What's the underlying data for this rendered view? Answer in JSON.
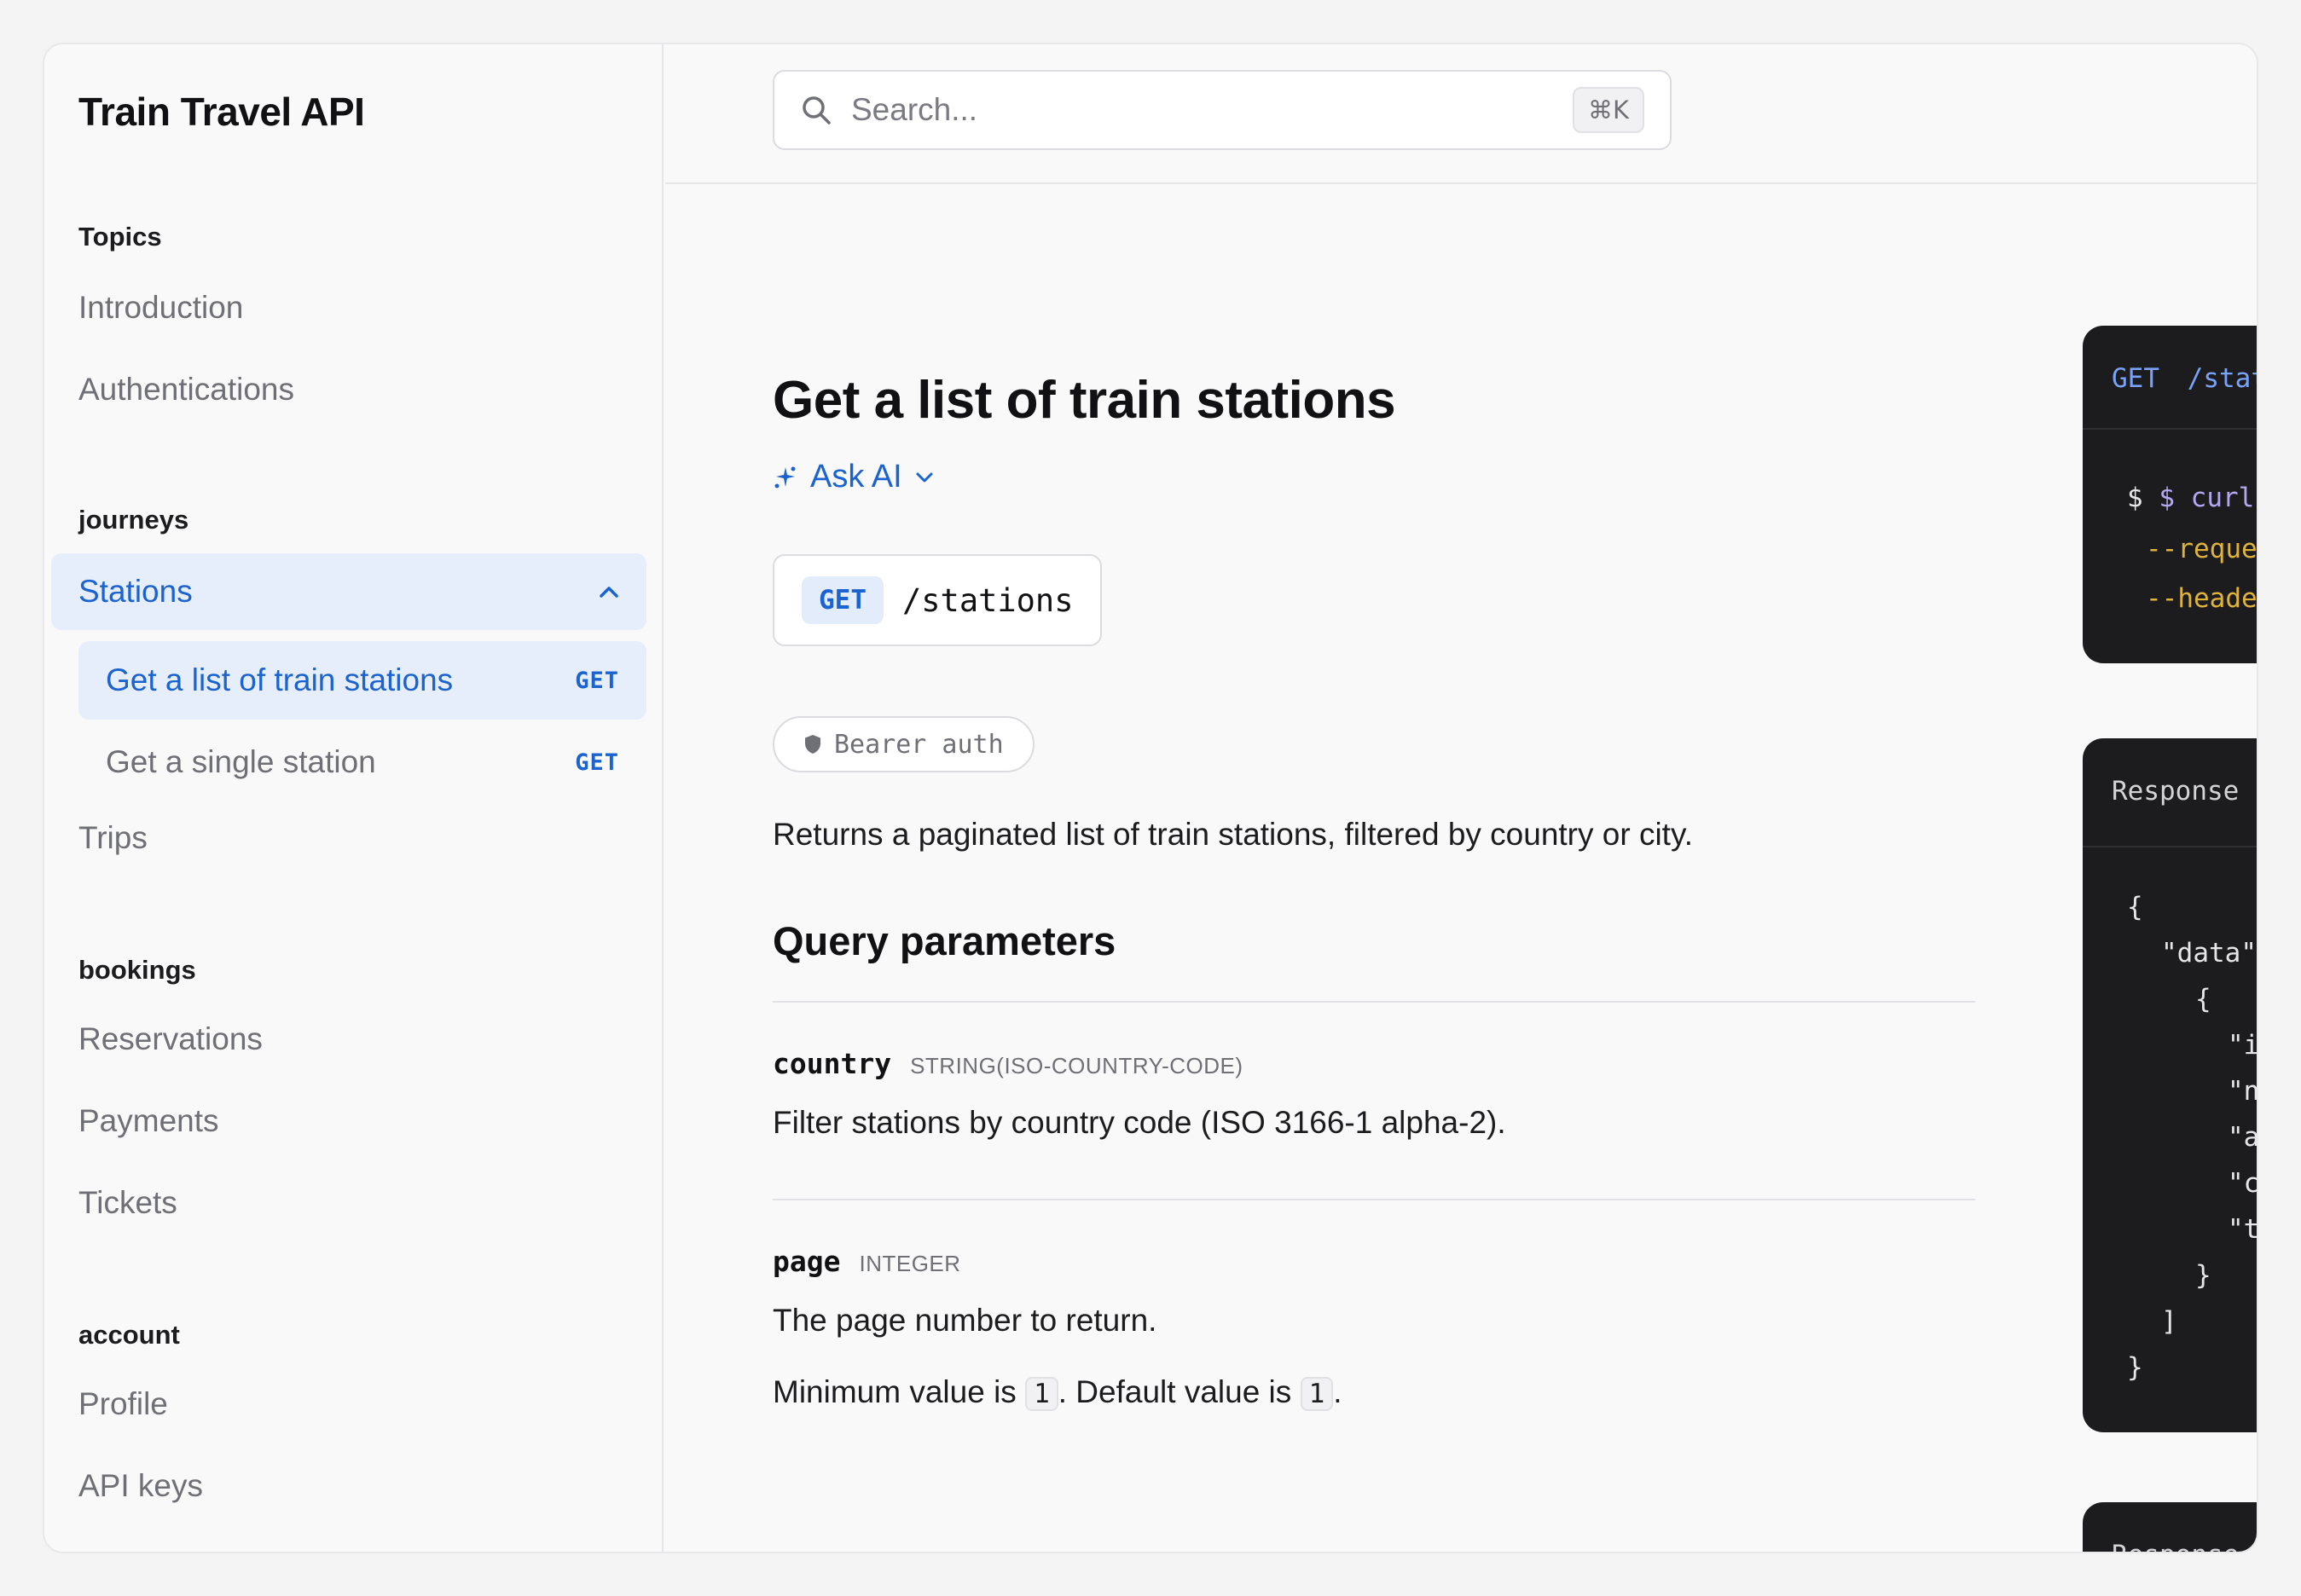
{
  "sidebar": {
    "brand": "Train Travel API",
    "sections": {
      "topics": {
        "title": "Topics",
        "items": [
          "Introduction",
          "Authentications"
        ]
      },
      "journeys": {
        "title": "journeys",
        "group": "Stations",
        "sub_items": [
          {
            "label": "Get a list of train stations",
            "method": "GET"
          },
          {
            "label": "Get a single station",
            "method": "GET"
          }
        ],
        "items": [
          "Trips"
        ]
      },
      "bookings": {
        "title": "bookings",
        "items": [
          "Reservations",
          "Payments",
          "Tickets"
        ]
      },
      "account": {
        "title": "account",
        "items": [
          "Profile",
          "API keys"
        ]
      }
    }
  },
  "search": {
    "placeholder": "Search...",
    "shortcut": "⌘K"
  },
  "main": {
    "title": "Get a list of train stations",
    "ask_ai": "Ask AI",
    "endpoint": {
      "method": "GET",
      "path": "/stations"
    },
    "auth": "Bearer auth",
    "description": "Returns a paginated list of train stations, filtered by country or city.",
    "query_heading": "Query parameters",
    "params": [
      {
        "name": "country",
        "type": "STRING(ISO-COUNTRY-CODE)",
        "description": "Filter stations by country code (ISO 3166-1 alpha-2)."
      },
      {
        "name": "page",
        "type": "INTEGER",
        "description": "The page number to return.",
        "constraint_prefix": "Minimum value is ",
        "min": "1",
        "constraint_mid": ". Default value is ",
        "default": "1",
        "constraint_suffix": "."
      }
    ]
  },
  "code_panels": {
    "request": {
      "method": "GET",
      "path": "/stat",
      "lines": [
        "$ curl \\",
        "--reque",
        "--heade"
      ]
    },
    "response": {
      "title": "Response",
      "lines": [
        "{",
        "\"data\"",
        "{",
        "\"i",
        "\"n",
        "\"a",
        "\"c",
        "\"t",
        "}",
        "]",
        "}"
      ]
    },
    "response2": {
      "title": "Response"
    }
  },
  "colors": {
    "accent": "#1b63d0",
    "accent_bg": "#e7eefb",
    "code_bg": "#1c1c1f",
    "code_blue": "#7aa2f7",
    "code_yellow": "#e0b43a",
    "code_purple": "#b4a7f0"
  }
}
